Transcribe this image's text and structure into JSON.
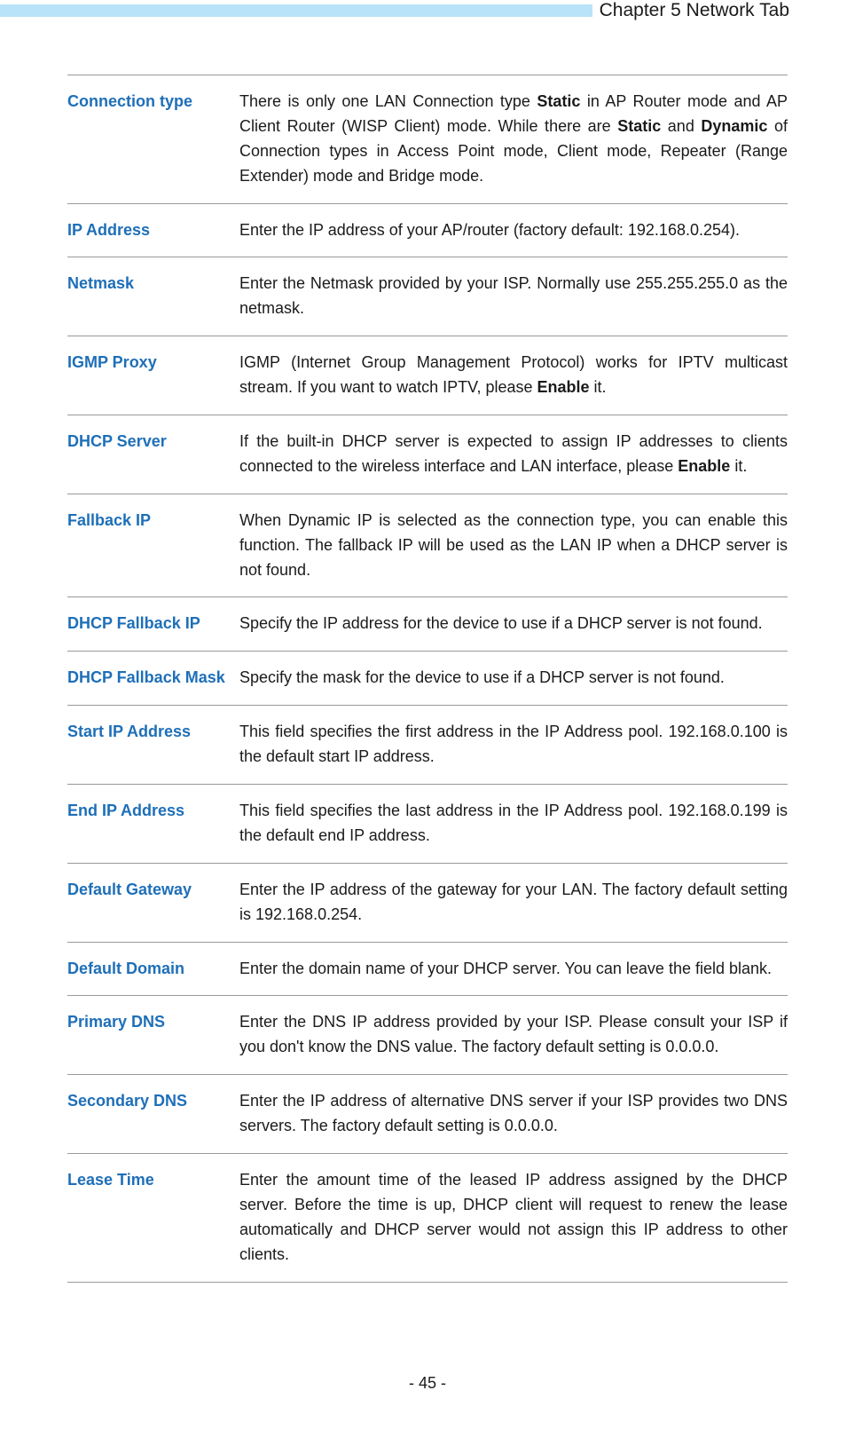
{
  "header": {
    "title": "Chapter 5 Network Tab"
  },
  "rows": [
    {
      "label": "Connection type",
      "desc": "There is only one LAN Connection type <b>Static</b> in AP Router mode and AP Client Router (WISP Client) mode. While there are <b>Static</b> and <b>Dynamic</b> of Connection types in Access Point mode, Client mode, Repeater (Range Extender) mode and Bridge mode."
    },
    {
      "label": "IP Address",
      "desc": "Enter the IP address of your AP/router (factory default: 192.168.0.254)."
    },
    {
      "label": "Netmask",
      "desc": "Enter the Netmask provided by your ISP. Normally use 255.255.255.0 as the netmask."
    },
    {
      "label": "IGMP Proxy",
      "desc": "IGMP (Internet Group Management Protocol) works for IPTV multicast stream. If you want to watch IPTV, please <b>Enable</b> it."
    },
    {
      "label": "DHCP Server",
      "desc": "If the built-in DHCP server is expected to assign IP addresses to clients connected to the wireless interface and LAN interface, please <b>Enable</b> it."
    },
    {
      "label": "Fallback IP",
      "desc": "When Dynamic IP is selected as the connection type, you can enable this function. The fallback IP will be used as the LAN IP when a DHCP server is not found."
    },
    {
      "label": "DHCP Fallback IP",
      "desc": "Specify the IP address for the device to use if a DHCP server is not found."
    },
    {
      "label": "DHCP Fallback Mask",
      "desc": "Specify the mask for the device to use if a DHCP server is not found."
    },
    {
      "label": "Start IP Address",
      "desc": "This field specifies the first address in the IP Address pool. 192.168.0.100 is the default start IP address."
    },
    {
      "label": "End IP Address",
      "desc": "This field specifies the last address in the IP Address pool. 192.168.0.199 is the default end IP address."
    },
    {
      "label": "Default Gateway",
      "desc": "Enter the IP address of the gateway for your LAN. The factory default setting is 192.168.0.254."
    },
    {
      "label": "Default Domain",
      "desc": "Enter the domain name of your DHCP server. You can leave the field blank."
    },
    {
      "label": "Primary DNS",
      "desc": "Enter the DNS IP address provided by your ISP. Please consult your ISP if you don't know the DNS value. The factory default setting is 0.0.0.0."
    },
    {
      "label": "Secondary DNS",
      "desc": "Enter the IP address of alternative DNS server if your ISP provides two DNS servers. The factory default setting is 0.0.0.0."
    },
    {
      "label": "Lease Time",
      "desc": "Enter the amount time of the leased IP address assigned by the DHCP server. Before the time is up, DHCP client will request to renew the lease automatically and DHCP server would not assign this IP address to other clients."
    }
  ],
  "pageNumber": "- 45 -"
}
